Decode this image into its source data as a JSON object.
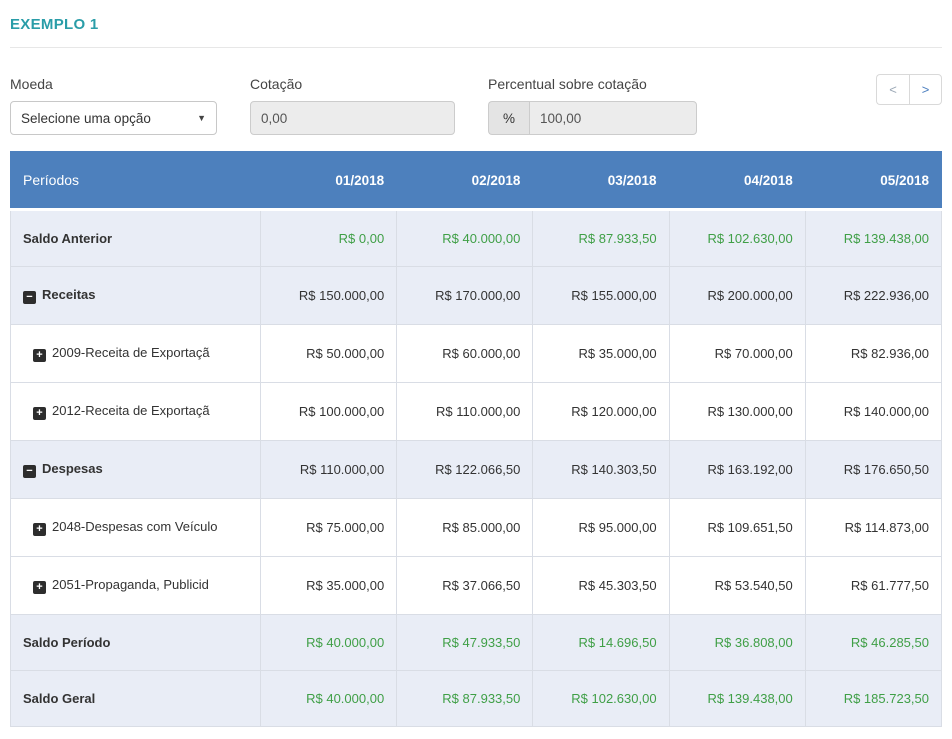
{
  "page": {
    "title": "EXEMPLO 1"
  },
  "filters": {
    "moeda": {
      "label": "Moeda",
      "selected": "Selecione uma opção"
    },
    "cotacao": {
      "label": "Cotação",
      "value": "0,00"
    },
    "percentual": {
      "label": "Percentual sobre cotação",
      "addon": "%",
      "value": "100,00"
    }
  },
  "pagination": {
    "prev": "<",
    "next": ">"
  },
  "colors": {
    "header_blue": "#4d80bd",
    "accent_teal": "#2a9da8",
    "positive_green": "#3f9f46",
    "shaded_row": "#e9edf6"
  },
  "table": {
    "first_header": "Períodos",
    "columns": [
      "01/2018",
      "02/2018",
      "03/2018",
      "04/2018",
      "05/2018"
    ],
    "rows": [
      {
        "label": "Saldo Anterior",
        "icon": null,
        "bold": true,
        "green": true,
        "shaded": true,
        "indent": false,
        "values": [
          "R$ 0,00",
          "R$ 40.000,00",
          "R$ 87.933,50",
          "R$ 102.630,00",
          "R$ 139.438,00"
        ]
      },
      {
        "label": "Receitas",
        "icon": "minus-square",
        "bold": true,
        "green": false,
        "shaded": true,
        "indent": false,
        "values": [
          "R$ 150.000,00",
          "R$ 170.000,00",
          "R$ 155.000,00",
          "R$ 200.000,00",
          "R$ 222.936,00"
        ]
      },
      {
        "label": "2009-Receita de Exportaçã",
        "icon": "plus-square",
        "bold": false,
        "green": false,
        "shaded": false,
        "indent": true,
        "values": [
          "R$ 50.000,00",
          "R$ 60.000,00",
          "R$ 35.000,00",
          "R$ 70.000,00",
          "R$ 82.936,00"
        ]
      },
      {
        "label": "2012-Receita de Exportaçã",
        "icon": "plus-square",
        "bold": false,
        "green": false,
        "shaded": false,
        "indent": true,
        "values": [
          "R$ 100.000,00",
          "R$ 110.000,00",
          "R$ 120.000,00",
          "R$ 130.000,00",
          "R$ 140.000,00"
        ]
      },
      {
        "label": "Despesas",
        "icon": "minus-square",
        "bold": true,
        "green": false,
        "shaded": true,
        "indent": false,
        "values": [
          "R$ 110.000,00",
          "R$ 122.066,50",
          "R$ 140.303,50",
          "R$ 163.192,00",
          "R$ 176.650,50"
        ]
      },
      {
        "label": "2048-Despesas com Veículo",
        "icon": "plus-square",
        "bold": false,
        "green": false,
        "shaded": false,
        "indent": true,
        "values": [
          "R$ 75.000,00",
          "R$ 85.000,00",
          "R$ 95.000,00",
          "R$ 109.651,50",
          "R$ 114.873,00"
        ]
      },
      {
        "label": "2051-Propaganda, Publicid",
        "icon": "plus-square",
        "bold": false,
        "green": false,
        "shaded": false,
        "indent": true,
        "values": [
          "R$ 35.000,00",
          "R$ 37.066,50",
          "R$ 45.303,50",
          "R$ 53.540,50",
          "R$ 61.777,50"
        ]
      },
      {
        "label": "Saldo Período",
        "icon": null,
        "bold": true,
        "green": true,
        "shaded": true,
        "indent": false,
        "values": [
          "R$ 40.000,00",
          "R$ 47.933,50",
          "R$ 14.696,50",
          "R$ 36.808,00",
          "R$ 46.285,50"
        ]
      },
      {
        "label": "Saldo Geral",
        "icon": null,
        "bold": true,
        "green": true,
        "shaded": true,
        "indent": false,
        "values": [
          "R$ 40.000,00",
          "R$ 87.933,50",
          "R$ 102.630,00",
          "R$ 139.438,00",
          "R$ 185.723,50"
        ]
      }
    ]
  }
}
